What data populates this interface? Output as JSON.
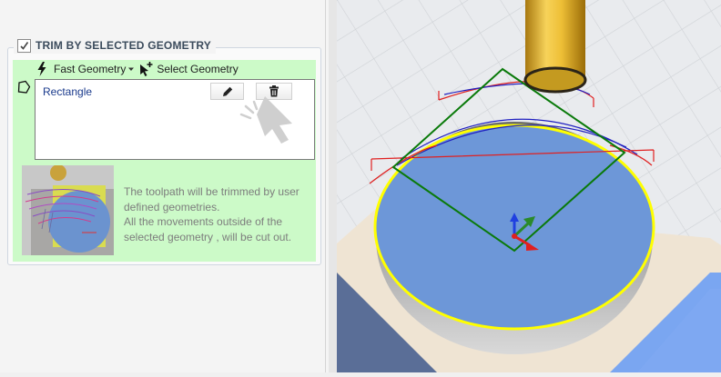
{
  "panel": {
    "group_title": "TRIM BY SELECTED GEOMETRY",
    "group_checked": true,
    "toolbar": {
      "fast_geometry_label": "Fast Geometry",
      "select_geometry_label": "Select Geometry"
    },
    "geometry_list": {
      "items": [
        {
          "label": "Rectangle",
          "actions": [
            "pencil-icon",
            "trash-icon"
          ]
        }
      ]
    },
    "description": {
      "lines": [
        "The toolpath will be trimmed by user",
        "defined geometries.",
        "All the movements outside of the",
        "selected geometry , will be cut out."
      ]
    }
  },
  "colors": {
    "panel_bg": "#ccfac8",
    "title_text": "#3b4b5c",
    "list_text": "#1a3a8c",
    "description_text": "#7d7d7d",
    "part_face": "#6d97d8",
    "part_edge": "#ffff00",
    "trim_rectangle": "#0a7a0a",
    "tool": "#e8b830"
  },
  "icons": [
    "checkbox-icon",
    "lightning-icon",
    "dropdown-arrow-icon",
    "cursor-plus-icon",
    "polygon-icon",
    "pencil-icon",
    "trash-icon",
    "pointer-cursor-icon",
    "axis-triad-icon"
  ]
}
